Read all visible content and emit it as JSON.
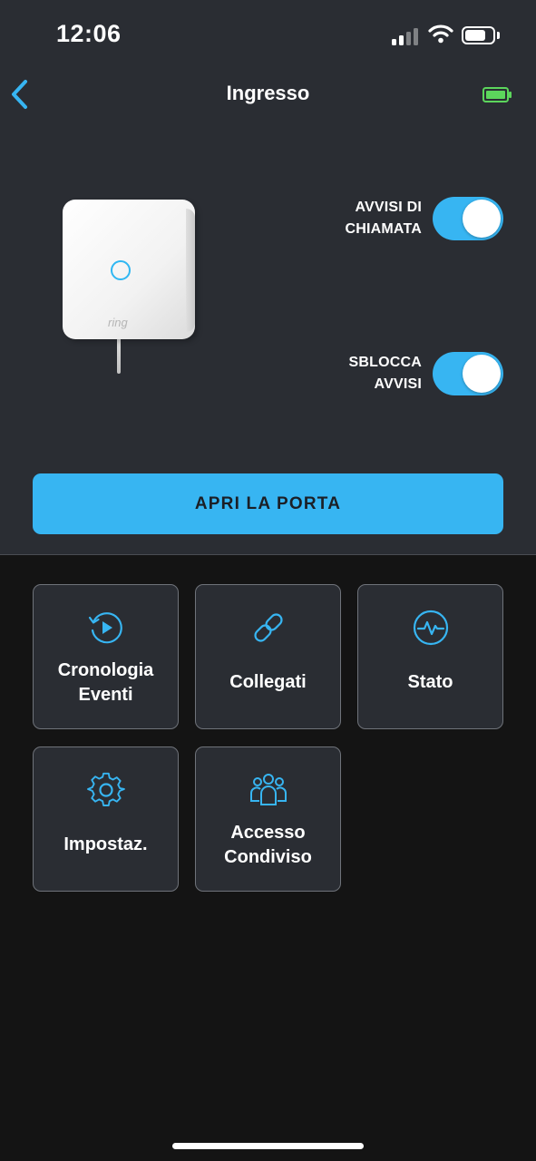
{
  "status_bar": {
    "time": "12:06"
  },
  "header": {
    "title": "Ingresso"
  },
  "device": {
    "brand": "ring"
  },
  "toggles": [
    {
      "line1": "AVVISI DI",
      "line2": "CHIAMATA",
      "on": true
    },
    {
      "line1": "SBLOCCA",
      "line2": "AVVISI",
      "on": true
    }
  ],
  "primary_action": {
    "label": "APRI LA PORTA"
  },
  "tiles": [
    {
      "line1": "Cronologia",
      "line2": "Eventi",
      "icon": "history-icon"
    },
    {
      "line1": "Collegati",
      "line2": "",
      "icon": "link-icon"
    },
    {
      "line1": "Stato",
      "line2": "",
      "icon": "health-icon"
    },
    {
      "line1": "Impostaz.",
      "line2": "",
      "icon": "gear-icon"
    },
    {
      "line1": "Accesso",
      "line2": "Condiviso",
      "icon": "people-icon"
    }
  ],
  "colors": {
    "accent": "#37b5f2",
    "top_background": "#2a2d33",
    "bottom_background": "#141414",
    "battery_green": "#5cd65c"
  }
}
